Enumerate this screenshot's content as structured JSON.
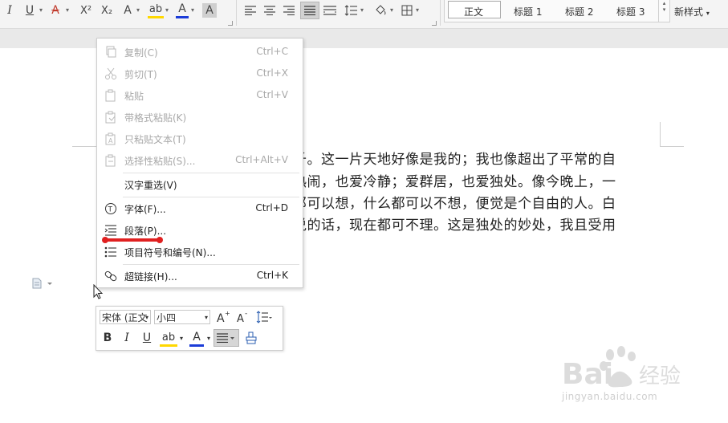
{
  "ribbon": {
    "format_buttons": [
      "I",
      "U",
      "A",
      "X²",
      "X₂",
      "A",
      "ab",
      "A",
      "A"
    ],
    "styles": [
      "正文",
      "标题 1",
      "标题 2",
      "标题 3"
    ],
    "new_style": "新样式"
  },
  "document": {
    "lines": [
      "千。这一片天地好像是我的；我也像超出了平常的自",
      "热闹，也爱冷静；爱群居，也爱独处。像今晚上，一",
      "邓可以想，什么都可以不想，便觉是个自由的人。白",
      "说的话，现在都可不理。这是独处的妙处，我且受用"
    ]
  },
  "context_menu": {
    "items": [
      {
        "label": "复制(C)",
        "shortcut": "Ctrl+C",
        "icon": "copy-icon",
        "enabled": false
      },
      {
        "label": "剪切(T)",
        "shortcut": "Ctrl+X",
        "icon": "scissors-icon",
        "enabled": false
      },
      {
        "label": "粘贴",
        "shortcut": "Ctrl+V",
        "icon": "paste-icon",
        "enabled": false
      },
      {
        "label": "带格式粘贴(K)",
        "shortcut": "",
        "icon": "paste-format-icon",
        "enabled": false
      },
      {
        "label": "只粘贴文本(T)",
        "shortcut": "",
        "icon": "paste-text-icon",
        "enabled": false
      },
      {
        "label": "选择性粘贴(S)...",
        "shortcut": "Ctrl+Alt+V",
        "icon": "paste-special-icon",
        "enabled": false
      },
      {
        "label": "汉字重选(V)",
        "shortcut": "",
        "icon": "",
        "enabled": true
      },
      {
        "label": "字体(F)...",
        "shortcut": "Ctrl+D",
        "icon": "font-icon",
        "enabled": true
      },
      {
        "label": "段落(P)...",
        "shortcut": "",
        "icon": "paragraph-icon",
        "enabled": true
      },
      {
        "label": "项目符号和编号(N)...",
        "shortcut": "",
        "icon": "bullet-list-icon",
        "enabled": true
      },
      {
        "label": "超链接(H)...",
        "shortcut": "Ctrl+K",
        "icon": "link-icon",
        "enabled": true
      }
    ]
  },
  "mini_toolbar": {
    "font_name": "宋体 (正文",
    "font_size": "小四",
    "buttons": [
      "B",
      "I",
      "U",
      "ab",
      "A"
    ]
  },
  "watermark": {
    "brand": "Bai",
    "brand_tail": "经验",
    "url": "jingyan.baidu.com"
  },
  "colors": {
    "highlight": "#ffd800",
    "font_color": "#1b3cd8",
    "annotation_red": "#e02020"
  }
}
